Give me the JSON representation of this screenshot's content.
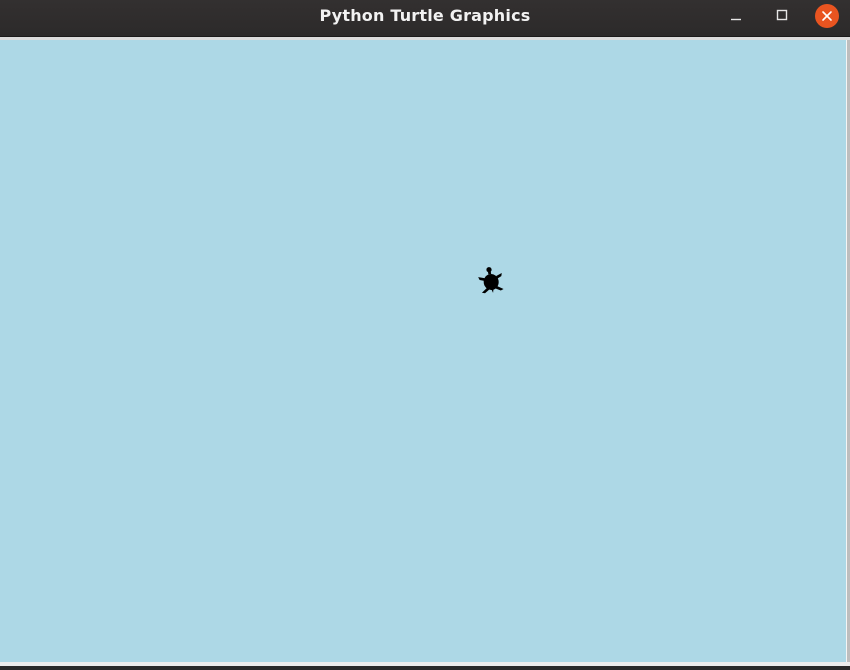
{
  "window": {
    "title": "Python Turtle Graphics",
    "controls": {
      "minimize_icon": "minimize-icon",
      "maximize_icon": "maximize-icon",
      "close_icon": "close-icon"
    }
  },
  "canvas": {
    "background_color": "#add8e6"
  },
  "turtle": {
    "shape": "turtle",
    "color": "#000000"
  },
  "theme": {
    "titlebar_color": "#2f2c2c",
    "title_text_color": "#f2f2f2",
    "close_button_color": "#e95420"
  }
}
